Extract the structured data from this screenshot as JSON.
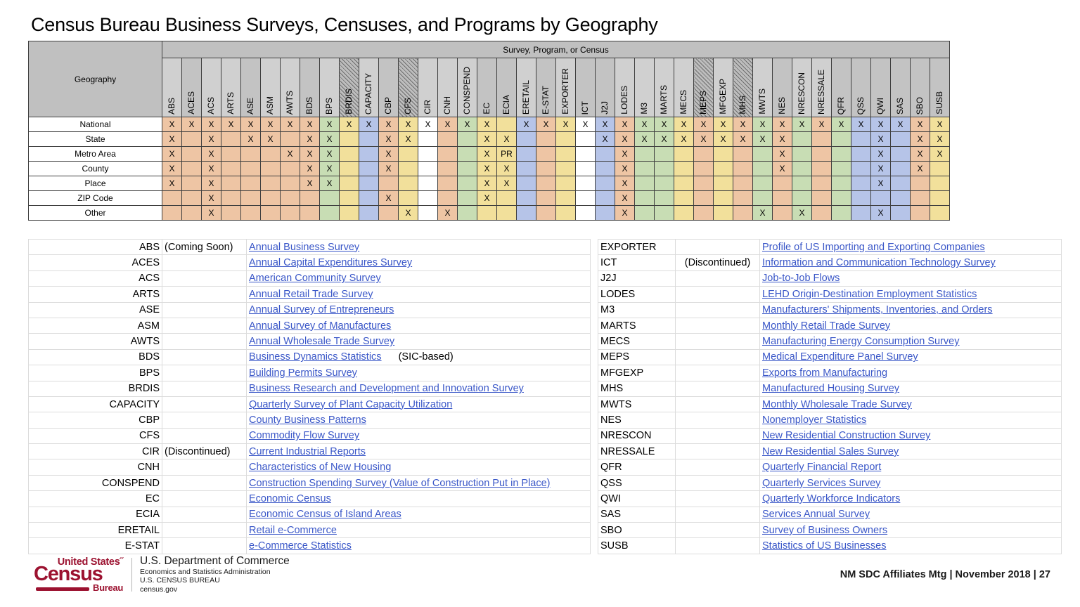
{
  "title": "Census Bureau Business Surveys, Censuses, and Programs by Geography",
  "matrix": {
    "geo_header": "Geography",
    "span_header": "Survey, Program, or Census",
    "columns": [
      {
        "abbr": "ABS",
        "shade": "light",
        "hatch": false
      },
      {
        "abbr": "ACES",
        "shade": "dark",
        "hatch": false
      },
      {
        "abbr": "ACS",
        "shade": "light",
        "hatch": false
      },
      {
        "abbr": "ARTS",
        "shade": "light",
        "hatch": false
      },
      {
        "abbr": "ASE",
        "shade": "dark",
        "hatch": false
      },
      {
        "abbr": "ASM",
        "shade": "light",
        "hatch": false
      },
      {
        "abbr": "AWTS",
        "shade": "light",
        "hatch": false
      },
      {
        "abbr": "BDS",
        "shade": "dark",
        "hatch": false
      },
      {
        "abbr": "BPS",
        "shade": "light",
        "hatch": false
      },
      {
        "abbr": "BRDIS",
        "shade": "dark",
        "hatch": true
      },
      {
        "abbr": "CAPACITY",
        "shade": "light",
        "hatch": false
      },
      {
        "abbr": "CBP",
        "shade": "dark",
        "hatch": false
      },
      {
        "abbr": "CFS",
        "shade": "dark",
        "hatch": true
      },
      {
        "abbr": "CIR",
        "shade": "light",
        "hatch": false
      },
      {
        "abbr": "CNH",
        "shade": "light",
        "hatch": false
      },
      {
        "abbr": "CONSPEND",
        "shade": "light",
        "hatch": false
      },
      {
        "abbr": "EC",
        "shade": "dark",
        "hatch": false
      },
      {
        "abbr": "ECIA",
        "shade": "dark",
        "hatch": false
      },
      {
        "abbr": "ERETAIL",
        "shade": "light",
        "hatch": false
      },
      {
        "abbr": "E-STAT",
        "shade": "dark",
        "hatch": false
      },
      {
        "abbr": "EXPORTER",
        "shade": "light",
        "hatch": false
      },
      {
        "abbr": "ICT",
        "shade": "dark",
        "hatch": false
      },
      {
        "abbr": "J2J",
        "shade": "dark",
        "hatch": false
      },
      {
        "abbr": "LODES",
        "shade": "light",
        "hatch": false
      },
      {
        "abbr": "M3",
        "shade": "light",
        "hatch": false
      },
      {
        "abbr": "MARTS",
        "shade": "light",
        "hatch": false
      },
      {
        "abbr": "MECS",
        "shade": "light",
        "hatch": false
      },
      {
        "abbr": "MEPS",
        "shade": "dark",
        "hatch": true
      },
      {
        "abbr": "MFGEXP",
        "shade": "light",
        "hatch": false
      },
      {
        "abbr": "MHS",
        "shade": "dark",
        "hatch": true
      },
      {
        "abbr": "MWTS",
        "shade": "light",
        "hatch": false
      },
      {
        "abbr": "NES",
        "shade": "dark",
        "hatch": false
      },
      {
        "abbr": "NRESCON",
        "shade": "light",
        "hatch": false
      },
      {
        "abbr": "NRESSALE",
        "shade": "light",
        "hatch": false
      },
      {
        "abbr": "QFR",
        "shade": "dark",
        "hatch": false
      },
      {
        "abbr": "QSS",
        "shade": "dark",
        "hatch": false
      },
      {
        "abbr": "QWI",
        "shade": "dark",
        "hatch": false
      },
      {
        "abbr": "SAS",
        "shade": "dark",
        "hatch": false
      },
      {
        "abbr": "SBO",
        "shade": "dark",
        "hatch": false
      },
      {
        "abbr": "SUSB",
        "shade": "dark",
        "hatch": false
      }
    ],
    "col_colors": [
      "or",
      "or",
      "or",
      "or",
      "or",
      "or",
      "or",
      "or",
      "gr",
      "ye",
      "bl",
      "or",
      "ye",
      "wh",
      "or",
      "gr",
      "ye",
      "ye",
      "bl",
      "or",
      "ye",
      "wh",
      "bl",
      "or",
      "gr",
      "gr",
      "ye",
      "or",
      "ye",
      "or",
      "gr",
      "or",
      "gr",
      "or",
      "gr",
      "bl",
      "bl",
      "bl",
      "or",
      "ye",
      "or"
    ],
    "rows": [
      {
        "label": "National",
        "marks": [
          "X",
          "X",
          "X",
          "X",
          "X",
          "X",
          "X",
          "X",
          "X",
          "X",
          "X",
          "X",
          "X",
          "X",
          "X",
          "X",
          "X",
          "",
          "X",
          "X",
          "X",
          "X",
          "X",
          "X",
          "X",
          "X",
          "X",
          "X",
          "X",
          "X",
          "X",
          "X",
          "X",
          "X",
          "X",
          "X",
          "X",
          "X",
          "X",
          "X"
        ]
      },
      {
        "label": "State",
        "marks": [
          "X",
          "",
          "X",
          "",
          "X",
          "X",
          "",
          "X",
          "X",
          "",
          "",
          "X",
          "X",
          "",
          "",
          "",
          "X",
          "X",
          "",
          "",
          "",
          "",
          "X",
          "X",
          "X",
          "X",
          "X",
          "X",
          "X",
          "X",
          "X",
          "X",
          "",
          "",
          "",
          "",
          "X",
          "",
          "X",
          "X"
        ]
      },
      {
        "label": "Metro Area",
        "marks": [
          "X",
          "",
          "X",
          "",
          "",
          "",
          "X",
          "X",
          "X",
          "",
          "",
          "X",
          "",
          "",
          "",
          "",
          "X",
          "PR",
          "",
          "",
          "",
          "",
          "",
          "X",
          "",
          "",
          "",
          "",
          "",
          "",
          "",
          "X",
          "",
          "",
          "",
          "",
          "X",
          "",
          "X",
          "X"
        ]
      },
      {
        "label": "County",
        "marks": [
          "X",
          "",
          "X",
          "",
          "",
          "",
          "",
          "X",
          "X",
          "",
          "",
          "X",
          "",
          "",
          "",
          "",
          "X",
          "X",
          "",
          "",
          "",
          "",
          "",
          "X",
          "",
          "",
          "",
          "",
          "",
          "",
          "",
          "X",
          "",
          "",
          "",
          "",
          "X",
          "",
          "X",
          ""
        ]
      },
      {
        "label": "Place",
        "marks": [
          "X",
          "",
          "X",
          "",
          "",
          "",
          "",
          "X",
          "X",
          "",
          "",
          "",
          "",
          "",
          "",
          "",
          "X",
          "X",
          "",
          "",
          "",
          "",
          "",
          "X",
          "",
          "",
          "",
          "",
          "",
          "",
          "",
          "",
          "",
          "",
          "",
          "",
          "X",
          "",
          "",
          ""
        ]
      },
      {
        "label": "ZIP Code",
        "marks": [
          "",
          "",
          "X",
          "",
          "",
          "",
          "",
          "",
          "",
          "",
          "",
          "X",
          "",
          "",
          "",
          "",
          "X",
          "",
          "",
          "",
          "",
          "",
          "",
          "X",
          "",
          "",
          "",
          "",
          "",
          "",
          "",
          "",
          "",
          "",
          "",
          "",
          "",
          "",
          "",
          ""
        ]
      },
      {
        "label": "Other",
        "marks": [
          "",
          "",
          "X",
          "",
          "",
          "",
          "",
          "",
          "",
          "",
          "",
          "",
          "X",
          "",
          "X",
          "",
          "",
          "",
          "",
          "",
          "",
          "",
          "",
          "X",
          "",
          "",
          "",
          "",
          "",
          "",
          "X",
          "",
          "X",
          "",
          "",
          "",
          "X",
          "",
          "",
          ""
        ]
      }
    ]
  },
  "legend_left": [
    {
      "abbr": "ABS",
      "note": "(Coming Soon)",
      "name": "Annual Business Survey",
      "suffix": ""
    },
    {
      "abbr": "ACES",
      "note": "",
      "name": "Annual Capital Expenditures Survey",
      "suffix": ""
    },
    {
      "abbr": "ACS",
      "note": "",
      "name": "American Community Survey",
      "suffix": ""
    },
    {
      "abbr": "ARTS",
      "note": "",
      "name": "Annual Retail Trade Survey",
      "suffix": ""
    },
    {
      "abbr": "ASE",
      "note": "",
      "name": "Annual Survey of Entrepreneurs",
      "suffix": ""
    },
    {
      "abbr": "ASM",
      "note": "",
      "name": "Annual Survey of Manufactures",
      "suffix": ""
    },
    {
      "abbr": "AWTS",
      "note": "",
      "name": "Annual Wholesale Trade Survey",
      "suffix": ""
    },
    {
      "abbr": "BDS",
      "note": "",
      "name": "Business Dynamics Statistics",
      "suffix": "(SIC-based)"
    },
    {
      "abbr": "BPS",
      "note": "",
      "name": "Building Permits Survey",
      "suffix": ""
    },
    {
      "abbr": "BRDIS",
      "note": "",
      "name": "Business Research and Development and Innovation Survey",
      "suffix": ""
    },
    {
      "abbr": "CAPACITY",
      "note": "",
      "name": "Quarterly Survey of Plant Capacity Utilization",
      "suffix": ""
    },
    {
      "abbr": "CBP",
      "note": "",
      "name": "County Business Patterns",
      "suffix": ""
    },
    {
      "abbr": "CFS",
      "note": "",
      "name": "Commodity Flow Survey",
      "suffix": ""
    },
    {
      "abbr": "CIR",
      "note": "(Discontinued)",
      "name": "Current Industrial Reports",
      "suffix": ""
    },
    {
      "abbr": "CNH",
      "note": "",
      "name": "Characteristics of New Housing",
      "suffix": ""
    },
    {
      "abbr": "CONSPEND",
      "note": "",
      "name": "Construction Spending Survey (Value of Construction Put in Place)",
      "suffix": ""
    },
    {
      "abbr": "EC",
      "note": "",
      "name": "Economic Census",
      "suffix": ""
    },
    {
      "abbr": "ECIA",
      "note": "",
      "name": "Economic Census of Island Areas",
      "suffix": ""
    },
    {
      "abbr": "ERETAIL",
      "note": "",
      "name": "Retail e-Commerce",
      "suffix": ""
    },
    {
      "abbr": "E-STAT",
      "note": "",
      "name": "e-Commerce Statistics",
      "suffix": ""
    }
  ],
  "legend_right": [
    {
      "abbr": "EXPORTER",
      "note": "",
      "name": "Profile of US Importing and Exporting Companies"
    },
    {
      "abbr": "ICT",
      "note": "(Discontinued)",
      "name": "Information and Communication Technology Survey"
    },
    {
      "abbr": "J2J",
      "note": "",
      "name": "Job-to-Job Flows"
    },
    {
      "abbr": "LODES",
      "note": "",
      "name": "LEHD Origin-Destination Employment Statistics"
    },
    {
      "abbr": "M3",
      "note": "",
      "name": "Manufacturers' Shipments, Inventories, and Orders"
    },
    {
      "abbr": "MARTS",
      "note": "",
      "name": "Monthly Retail Trade Survey"
    },
    {
      "abbr": "MECS",
      "note": "",
      "name": "Manufacturing Energy Consumption Survey"
    },
    {
      "abbr": "MEPS",
      "note": "",
      "name": "Medical Expenditure Panel Survey"
    },
    {
      "abbr": "MFGEXP",
      "note": "",
      "name": "Exports from Manufacturing"
    },
    {
      "abbr": "MHS",
      "note": "",
      "name": "Manufactured Housing Survey"
    },
    {
      "abbr": "MWTS",
      "note": "",
      "name": "Monthly Wholesale Trade Survey"
    },
    {
      "abbr": "NES",
      "note": "",
      "name": "Nonemployer Statistics"
    },
    {
      "abbr": "NRESCON",
      "note": "",
      "name": "New Residential Construction Survey"
    },
    {
      "abbr": "NRESSALE",
      "note": "",
      "name": "New Residential Sales Survey"
    },
    {
      "abbr": "QFR",
      "note": "",
      "name": "Quarterly Financial Report"
    },
    {
      "abbr": "QSS",
      "note": "",
      "name": "Quarterly Services Survey"
    },
    {
      "abbr": "QWI",
      "note": "",
      "name": "Quarterly Workforce Indicators"
    },
    {
      "abbr": "SAS",
      "note": "",
      "name": "Services Annual Survey"
    },
    {
      "abbr": "SBO",
      "note": "",
      "name": "Survey of Business Owners"
    },
    {
      "abbr": "SUSB",
      "note": "",
      "name": "Statistics of US Businesses"
    }
  ],
  "footer": {
    "logo_us": "United States˝",
    "logo_census": "Census",
    "logo_bureau": "Bureau",
    "dept_line1": "U.S. Department of Commerce",
    "dept_line2": "Economics and Statistics Administration",
    "dept_line3": "U.S. CENSUS BUREAU",
    "dept_line4": "census.gov",
    "meeting": "NM SDC Affiliates Mtg |  November 2018  |  27"
  },
  "colors": {
    "orange": "#eec5a4",
    "green": "#c8ddb4",
    "yellow": "#f2e09b",
    "blue": "#b6c4e8",
    "white": "#ffffff",
    "header_gray": "#c0c0c0",
    "link_blue": "#3a57c8",
    "census_maroon": "#9c1230"
  }
}
